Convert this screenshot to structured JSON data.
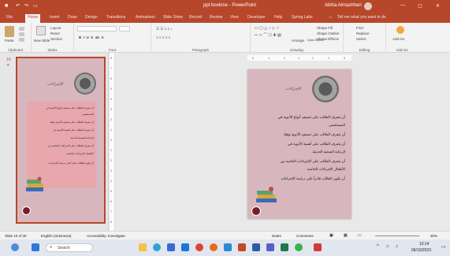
{
  "window": {
    "title": "ppt bookIse - PowerPoint",
    "user": "Abiha Almashhari"
  },
  "quick_access": [
    "save-icon",
    "undo-icon",
    "redo-icon",
    "slideshow-icon"
  ],
  "tabs": [
    {
      "label": "File",
      "active": false
    },
    {
      "label": "Home",
      "active": true
    },
    {
      "label": "Insert",
      "active": false
    },
    {
      "label": "Draw",
      "active": false
    },
    {
      "label": "Design",
      "active": false
    },
    {
      "label": "Transitions",
      "active": false
    },
    {
      "label": "Animations",
      "active": false
    },
    {
      "label": "Slide Show",
      "active": false
    },
    {
      "label": "Record",
      "active": false
    },
    {
      "label": "Review",
      "active": false
    },
    {
      "label": "View",
      "active": false
    },
    {
      "label": "Developer",
      "active": false
    },
    {
      "label": "Help",
      "active": false
    },
    {
      "label": "Spring Labs",
      "active": false
    }
  ],
  "tell_me": "Tell me what you want to do",
  "ribbon": {
    "clipboard": {
      "label": "Clipboard",
      "paste": "Paste"
    },
    "slides": {
      "label": "Slides",
      "new_slide": "New Slide",
      "layout": "Layout",
      "reset": "Reset",
      "section": "Section"
    },
    "font": {
      "label": "Font"
    },
    "paragraph": {
      "label": "Paragraph"
    },
    "drawing": {
      "label": "Drawing",
      "arrange": "Arrange",
      "quick_styles": "Quick Styles",
      "shape_fill": "Shape Fill",
      "shape_outline": "Shape Outline",
      "shape_effects": "Shape Effects"
    },
    "editing": {
      "label": "Editing",
      "find": "Find",
      "replace": "Replace",
      "select": "Select"
    },
    "addins": {
      "label": "Add-ins",
      "addins_btn": "Add-ins"
    }
  },
  "thumbnail": {
    "number": "10",
    "star": "★"
  },
  "slide": {
    "title": "الإجراءات",
    "bullets": [
      "أن يتعرف الطالب على تصنيف أنواع الأدوية في",
      "المستشفى.",
      "أن يتعرف الطالب على تصنيف الأدوية وفقا.",
      "أن يتعرف الطالب على أهمية الأدوية في",
      "الرعاية الصحية الحديثة.",
      "أن يتعرف الطالب على الإجراءات الخاصة من",
      "الأطفال الإجراءات الخاصة.",
      "أن يكون الطالب قادراً على دراسة الإجراءات"
    ]
  },
  "ruler": {
    "h_labels": [
      "6",
      "4",
      "2",
      "0",
      "2",
      "4",
      "6"
    ],
    "v_labels": [
      "8",
      "7",
      "6",
      "5",
      "4",
      "3",
      "2",
      "1",
      "0",
      "1",
      "2",
      "3",
      "4",
      "5",
      "6",
      "7",
      "8"
    ]
  },
  "status": {
    "slide_info": "Slide 10 of 30",
    "language": "English (Indonesia)",
    "accessibility": "Accessibility: Investigate",
    "notes": "Notes",
    "comments": "Comments",
    "zoom": "30%"
  },
  "taskbar": {
    "search": "Search",
    "time": "10:14",
    "date": "06/10/2023",
    "icons": [
      "windows-icon",
      "file-explorer-icon",
      "edge-icon",
      "store-icon",
      "mail-icon",
      "chrome-icon",
      "firefox-icon",
      "vscode-icon",
      "powerpoint-icon",
      "word-icon",
      "teams-icon",
      "excel-icon",
      "whatsapp-icon"
    ]
  }
}
